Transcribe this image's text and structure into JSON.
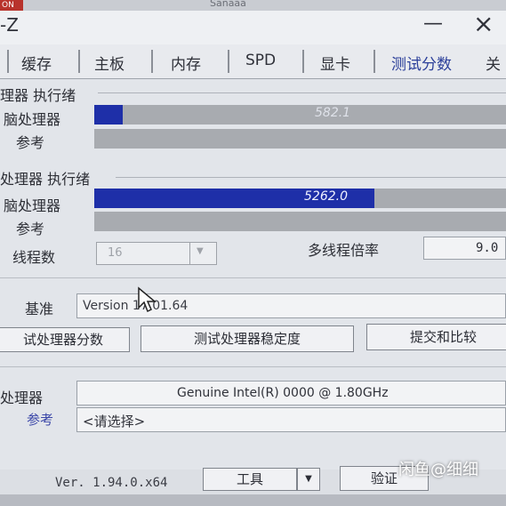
{
  "top_strip": {
    "red_tab": "ON",
    "text": "Sanaaa"
  },
  "window": {
    "title": "-Z",
    "minimize": "—",
    "close": "×"
  },
  "tabs": [
    "缓存",
    "主板",
    "内存",
    "SPD",
    "显卡",
    "测试分数"
  ],
  "tabs_edge": [
    "l",
    "关"
  ],
  "single_thread": {
    "section": "理器 执行绪",
    "cpu_label": "脑处理器",
    "cpu_value": "582.1",
    "cpu_fraction": 0.07,
    "ref_label": "参考"
  },
  "multi_thread": {
    "section": "处理器 执行绪",
    "cpu_label": "脑处理器",
    "cpu_value": "5262.0",
    "cpu_fraction": 0.68,
    "ref_label": "参考",
    "threads_label": "线程数",
    "threads_value": "16",
    "ratio_label": "多线程倍率",
    "ratio_value": "9.0"
  },
  "benchmark": {
    "label": "基准",
    "version": "Version 17.01.64"
  },
  "buttons": {
    "bench_cpu": "试处理器分数",
    "stress_cpu": "测试处理器稳定度",
    "submit": "提交和比较"
  },
  "processor": {
    "label": "处理器",
    "value": "Genuine Intel(R) 0000 @ 1.80GHz",
    "ref_label": "参考",
    "ref_value": "<请选择>"
  },
  "footer": {
    "version": "Ver. 1.94.0.x64",
    "tools": "工具",
    "dropdown": "▼",
    "validate": "验证"
  },
  "watermark": "闲鱼@细细",
  "colors": {
    "bar_fill": "#1e2fa8",
    "bar_track": "#a8abb0",
    "active_tab": "#2b3f9a"
  }
}
